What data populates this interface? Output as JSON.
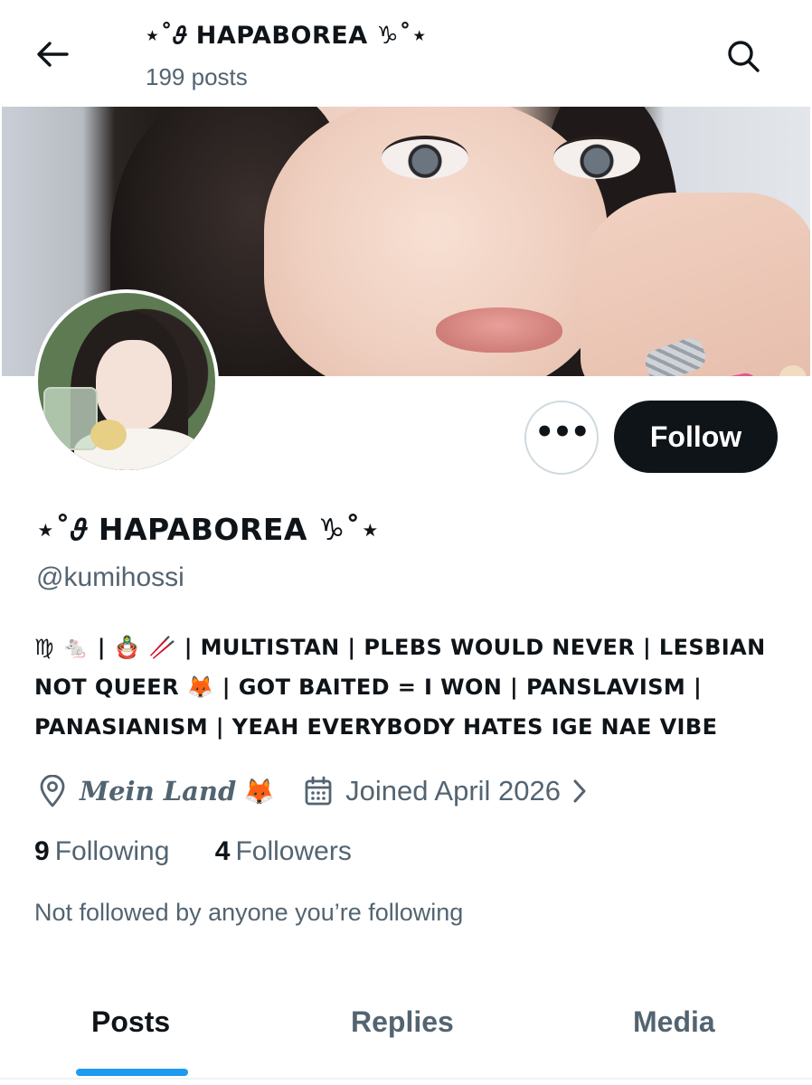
{
  "header": {
    "title": "⋆˚𝜗 HAPABOREA ♑︎˚⋆",
    "posts_count": "199 posts"
  },
  "profile": {
    "display_name": "⋆˚𝜗 HAPABOREA ♑︎˚⋆",
    "handle": "@kumihossi",
    "follow_label": "Follow",
    "more_label": "•••",
    "bio_lines": [
      "♍ 🐁 | 🪆 🥢 | MULTISTAN | PLEBS WOULD NEVER | LESBIAN",
      "NOT QUEER 🦊 | GOT BAITED = I WON | PANSLAVISM |",
      "PANASIANISM | YEAH EVERYBODY HATES IGE NAE VIBE"
    ],
    "location": "Mein Land",
    "location_emoji": "🦊",
    "joined": "Joined April 2026",
    "following_count": "9",
    "following_label": "Following",
    "followers_count": "4",
    "followers_label": "Followers",
    "mutuals_text": "Not followed by anyone you’re following"
  },
  "tabs": [
    {
      "label": "Posts"
    },
    {
      "label": "Replies"
    },
    {
      "label": "Media"
    }
  ],
  "colors": {
    "accent": "#1d9bf0",
    "text_primary": "#0f1419",
    "text_secondary": "#536471",
    "follow_bg": "#0f1419"
  },
  "icons": [
    "back-arrow-icon",
    "search-icon",
    "more-icon",
    "location-pin-icon",
    "calendar-icon",
    "chevron-right-icon"
  ]
}
